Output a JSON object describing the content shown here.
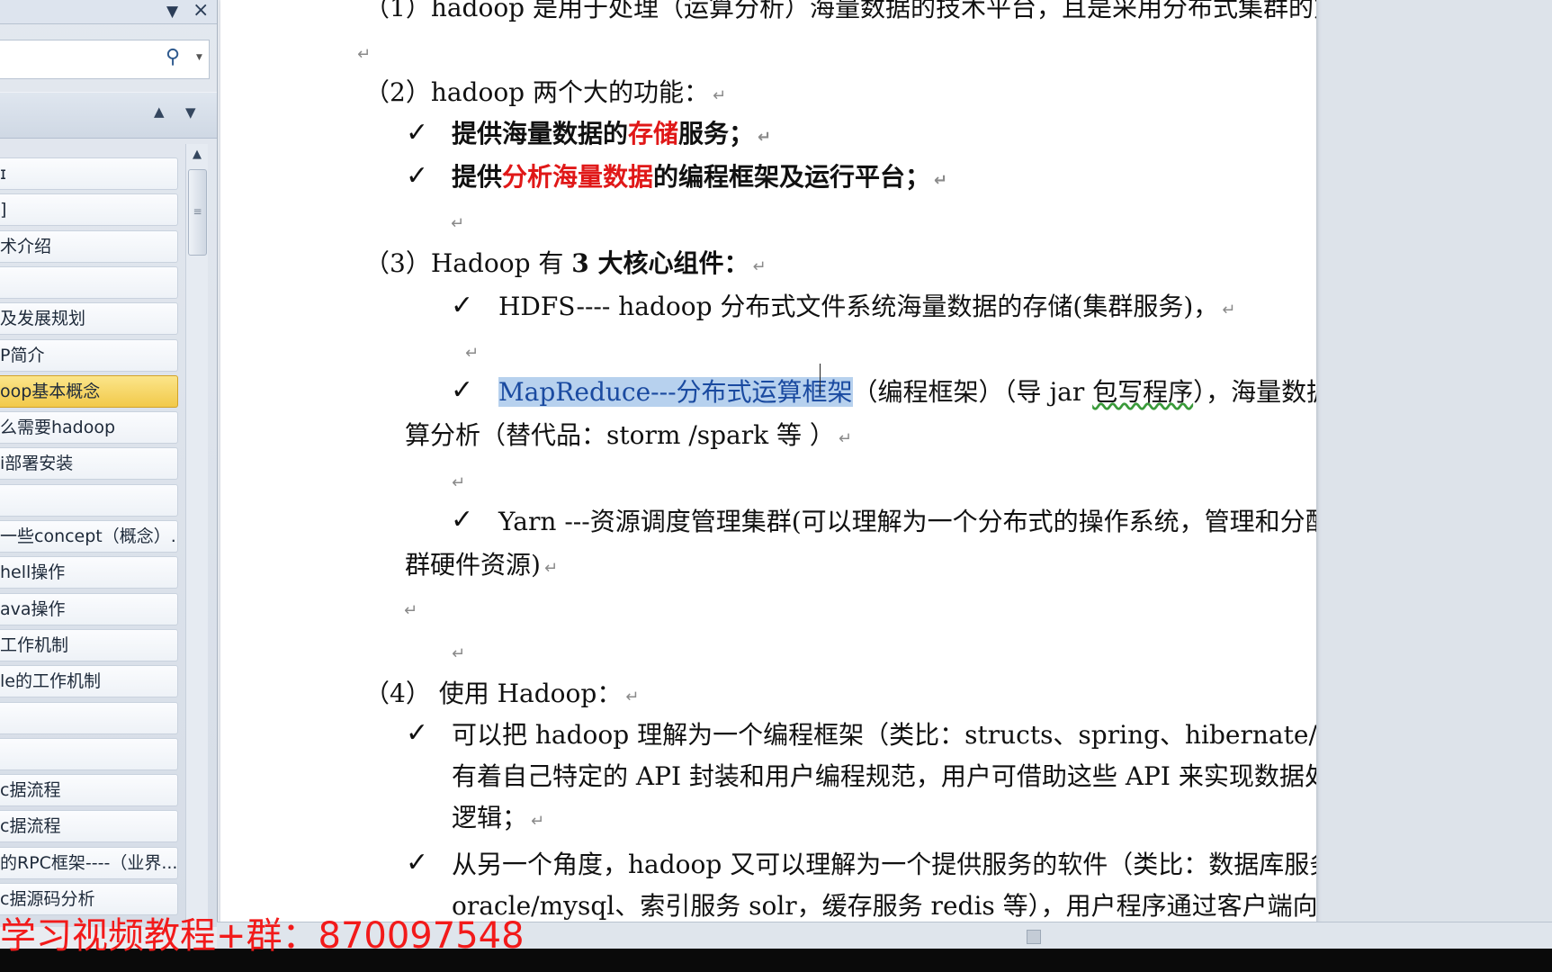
{
  "nav": {
    "search_placeholder": "",
    "items": [
      {
        "label": "ɪ"
      },
      {
        "label": "]"
      },
      {
        "label": "术介绍"
      },
      {
        "label": ""
      },
      {
        "label": "及发展规划"
      },
      {
        "label": "P简介"
      },
      {
        "label": "oop基本概念"
      },
      {
        "label": "么需要hadoop"
      },
      {
        "label": "i部署安装"
      },
      {
        "label": ""
      },
      {
        "label": "一些concept（概念）..."
      },
      {
        "label": "hell操作"
      },
      {
        "label": "ava操作"
      },
      {
        "label": "工作机制"
      },
      {
        "label": "le的工作机制"
      },
      {
        "label": ""
      },
      {
        "label": ""
      },
      {
        "label": "c据流程"
      },
      {
        "label": "c据流程"
      },
      {
        "label": "的RPC框架----（业界..."
      },
      {
        "label": "c据源码分析"
      }
    ],
    "selected_index": 6
  },
  "doc": {
    "l1": "（1）hadoop 是用于处理（运算分析）海量数据的技术平台，且是采用分布式集群的方式；",
    "l2": "（2）hadoop 两个大的功能：",
    "l2a_pre": "提供海量数据的",
    "l2a_red": "存储",
    "l2a_post": "服务；",
    "l2b_pre": "提供",
    "l2b_red": "分析海量数据",
    "l2b_post": "的编程框架及运行平台；",
    "l3_pre": "（3）Hadoop 有 ",
    "l3_bold": "3 大核心组件：",
    "hdfs": "HDFS---- hadoop 分布式文件系统海量数据的存储(集群服务)，",
    "mr_hl": "MapReduce---分布式运算框架",
    "mr_mid": "（编程框架）（导 jar ",
    "mr_spell": "包写程序",
    "mr_post": "），海量数据运",
    "mr_line2": "算分析（替代品：storm /spark 等 ）",
    "yarn_line1": "Yarn ---资源调度管理集群(可以理解为一个分布式的操作系统，管理和分配集",
    "yarn_line2": "群硬件资源)",
    "l4": "（4） 使用 Hadoop：",
    "l4a_1": "可以把 hadoop 理解为一个编程框架（类比：structs、spring、hibernate/mybatis），",
    "l4a_2": "有着自己特定的 API 封装和用户编程规范，用户可借助这些 API 来实现数据处理",
    "l4a_3": "逻辑；",
    "l4b_1": "从另一个角度，hadoop 又可以理解为一个提供服务的软件（类比：数据库服务",
    "l4b_2": "oracle/mysql、索引服务 solr，缓存服务 redis 等），用户程序通过客户端向 hadoop",
    "para_mark": "↵",
    "check_mark": "✓"
  },
  "watermark": "学习视频教程+群：870097548",
  "colors": {
    "highlight": "#b7d1ee",
    "red_text": "#e01818",
    "selected_nav": "#f2c94a",
    "watermark": "#f21a1a"
  }
}
